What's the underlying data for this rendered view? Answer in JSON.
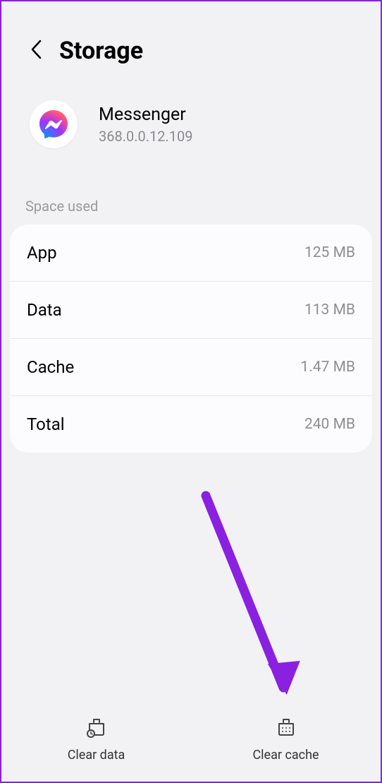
{
  "header": {
    "title": "Storage"
  },
  "app": {
    "name": "Messenger",
    "version": "368.0.0.12.109"
  },
  "section_label": "Space used",
  "storage": {
    "rows": [
      {
        "label": "App",
        "value": "125 MB"
      },
      {
        "label": "Data",
        "value": "113 MB"
      },
      {
        "label": "Cache",
        "value": "1.47 MB"
      },
      {
        "label": "Total",
        "value": "240 MB"
      }
    ]
  },
  "actions": {
    "clear_data": "Clear data",
    "clear_cache": "Clear cache"
  }
}
